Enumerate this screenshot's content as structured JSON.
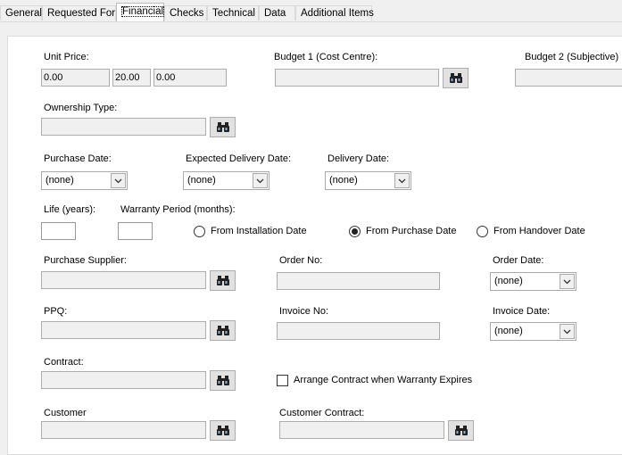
{
  "tabs": [
    "General",
    "Requested For",
    "Financial",
    "Checks",
    "Technical",
    "Data",
    "Additional Items"
  ],
  "labels": {
    "unit_price": "Unit Price:",
    "budget1": "Budget 1 (Cost Centre):",
    "budget2": "Budget 2 (Subjective)",
    "ownership": "Ownership Type:",
    "purchase_date": "Purchase Date:",
    "expected_delivery": "Expected Delivery Date:",
    "delivery_date": "Delivery Date:",
    "life": "Life (years):",
    "warranty": "Warranty Period (months):",
    "purchase_supplier": "Purchase Supplier:",
    "order_no": "Order No:",
    "order_date": "Order Date:",
    "ppq": "PPQ:",
    "invoice_no": "Invoice No:",
    "invoice_date": "Invoice Date:",
    "contract": "Contract:",
    "customer": "Customer",
    "customer_contract": "Customer Contract:"
  },
  "values": {
    "unit_price_1": "0.00",
    "unit_price_2": "20.00",
    "unit_price_3": "0.00",
    "purchase_date": "(none)",
    "expected_delivery": "(none)",
    "delivery_date": "(none)",
    "order_date": "(none)",
    "invoice_date": "(none)"
  },
  "warranty_options": [
    {
      "label": "From Installation Date",
      "selected": false
    },
    {
      "label": "From Purchase Date",
      "selected": true
    },
    {
      "label": "From Handover Date",
      "selected": false
    }
  ],
  "arrange_contract": {
    "label": "Arrange Contract when Warranty Expires",
    "checked": false
  },
  "icons": {
    "lookup": "binoculars-icon",
    "dropdown": "chevron-down-icon"
  }
}
